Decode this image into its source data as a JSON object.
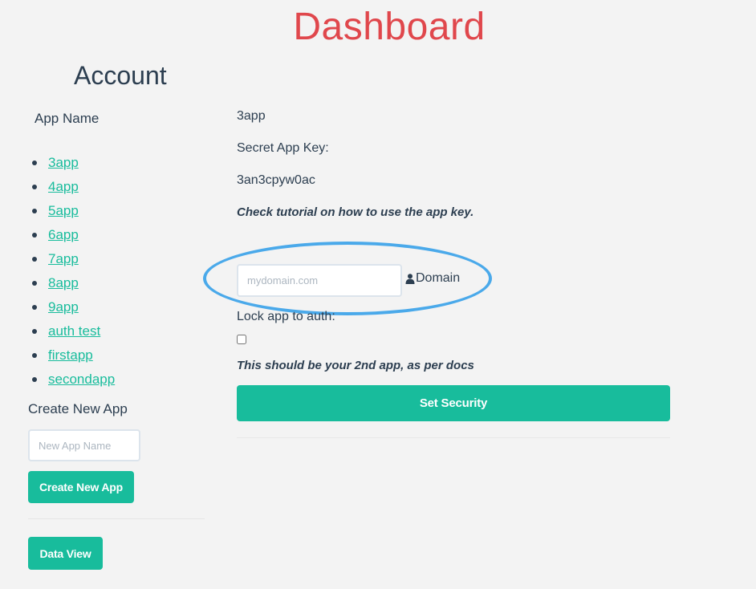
{
  "page": {
    "title": "Dashboard"
  },
  "sidebar": {
    "title": "Account",
    "app_name_label": "App Name",
    "apps": [
      "3app",
      "4app",
      "5app",
      "6app",
      "7app",
      "8app",
      "9app",
      "auth test",
      "firstapp",
      "secondapp"
    ],
    "create_label": "Create New App",
    "new_app_placeholder": "New App Name",
    "create_button": "Create New App",
    "data_view_button": "Data View"
  },
  "main": {
    "app_title": "3app",
    "secret_label": "Secret App Key:",
    "secret_value": "3an3cpyw0ac",
    "tutorial_note": "Check tutorial on how to use the app key.",
    "domain_placeholder": "mydomain.com",
    "domain_label": "Domain",
    "domain_icon": "user-icon",
    "lock_label": "Lock app to auth:",
    "lock_checked": false,
    "second_app_note": "This should be your 2nd app, as per docs",
    "set_security_button": "Set Security"
  },
  "colors": {
    "title": "#e0474c",
    "accent": "#18bc9c",
    "text": "#2c3e50",
    "highlight_ring": "#4aa9ea"
  }
}
